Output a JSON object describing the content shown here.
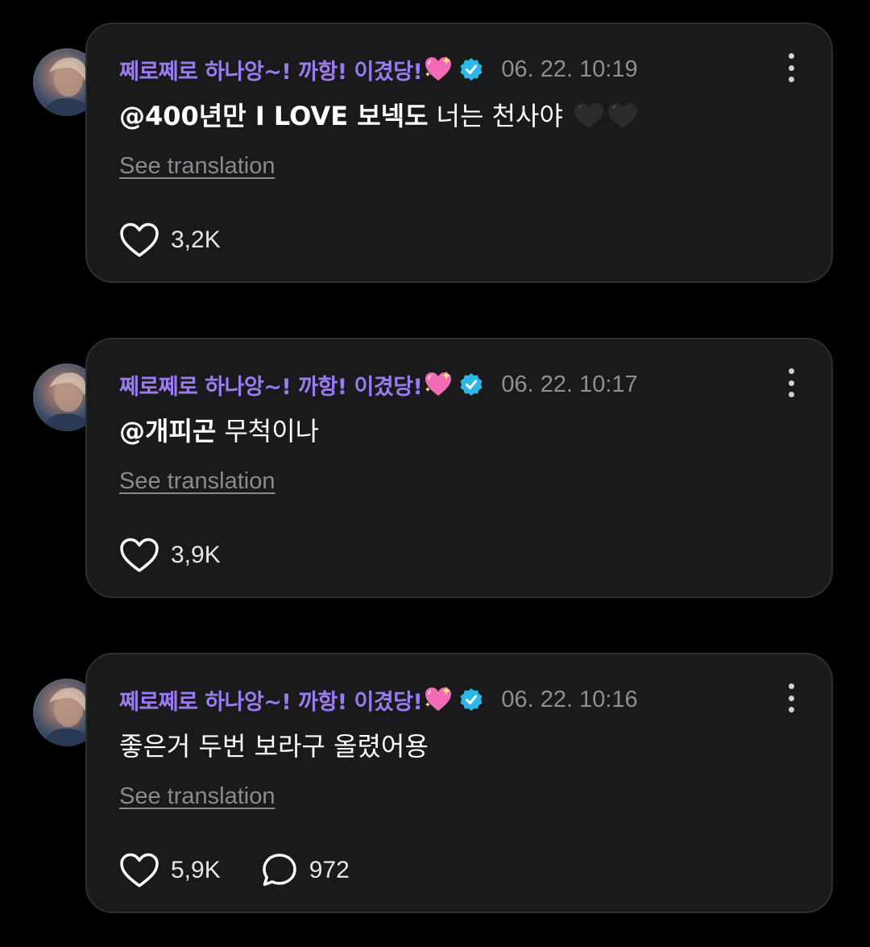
{
  "comments": [
    {
      "username": "쩨로쩨로 하나앙~! 까항! 이겼당!",
      "timestamp": "06. 22. 10:19",
      "mention": "@400년만 I LOVE 보넥도",
      "text": "너는 천사야",
      "emoji": [
        "black-heart",
        "black-heart"
      ],
      "translate_label": "See translation",
      "likes": "3,2K"
    },
    {
      "username": "쩨로쩨로 하나앙~! 까항! 이겼당!",
      "timestamp": "06. 22. 10:17",
      "mention": "@개피곤",
      "text": "무척이나",
      "translate_label": "See translation",
      "likes": "3,9K"
    },
    {
      "username": "쩨로쩨로 하나앙~! 까항! 이겼당!",
      "timestamp": "06. 22. 10:16",
      "mention": "",
      "text": "좋은거 두번 보라구 올렸어용",
      "translate_label": "See translation",
      "likes": "5,9K",
      "replies": "972"
    }
  ],
  "colors": {
    "username": "#9b7cf0",
    "verified": "#2bb8e6",
    "card": "#1a1a1c",
    "timestamp": "#8e8e93"
  },
  "icons": [
    "sparkling-heart-icon",
    "verified-badge-icon",
    "more-options-icon",
    "like-heart-icon",
    "reply-bubble-icon"
  ]
}
